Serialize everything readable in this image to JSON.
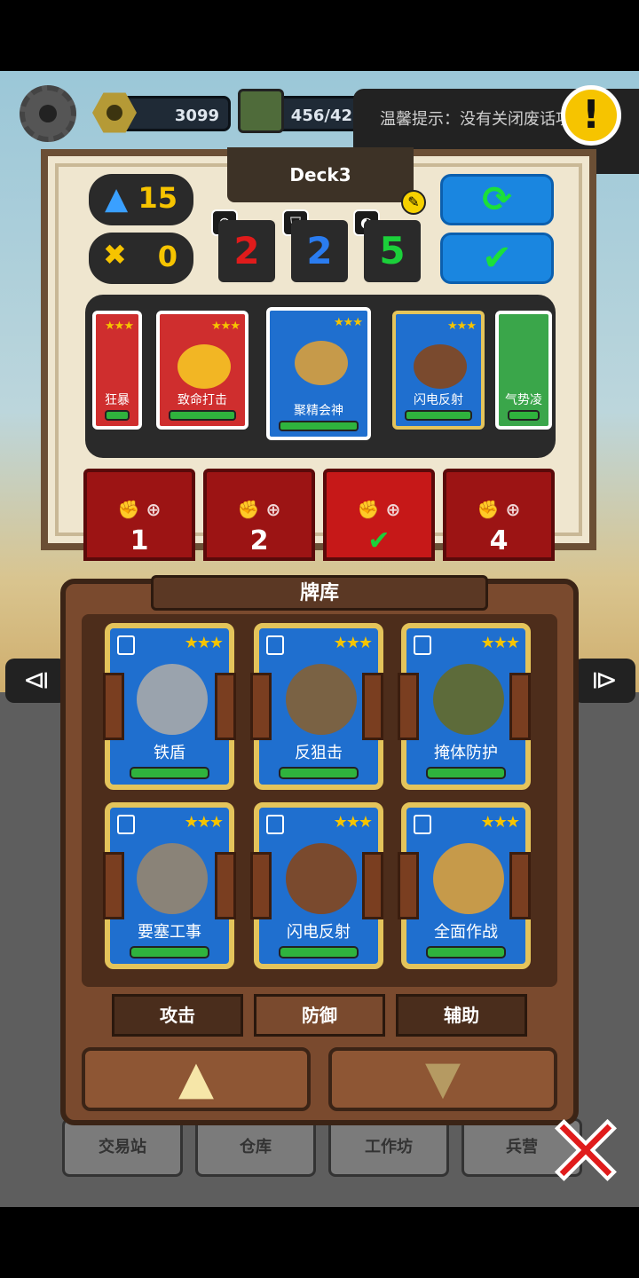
{
  "resources": {
    "nuts": "3099",
    "supplies": "456/42"
  },
  "toast": {
    "text": "温馨提示：没有关闭废话项…"
  },
  "deck": {
    "title": "Deck3"
  },
  "counters": {
    "cost": "15",
    "badge": "0"
  },
  "stats": {
    "attack": "2",
    "defense": "2",
    "support": "5"
  },
  "strip_cards": [
    {
      "label": "狂暴",
      "color": "red"
    },
    {
      "label": "致命打击",
      "color": "red"
    },
    {
      "label": "聚精会神",
      "color": "blue"
    },
    {
      "label": "闪电反射",
      "color": "blue"
    },
    {
      "label": "气势凌",
      "color": "green"
    }
  ],
  "slots": [
    "1",
    "2",
    "✔",
    "4"
  ],
  "library": {
    "title": "牌库",
    "cards": [
      {
        "label": "铁盾",
        "stars": "★★★"
      },
      {
        "label": "反狙击",
        "stars": "★★★"
      },
      {
        "label": "掩体防护",
        "stars": "★★★"
      },
      {
        "label": "要塞工事",
        "stars": "★★★"
      },
      {
        "label": "闪电反射",
        "stars": "★★★"
      },
      {
        "label": "全面作战",
        "stars": "★★★"
      }
    ],
    "tabs": [
      "攻击",
      "防御",
      "辅助"
    ]
  },
  "bottom_nav": [
    "交易站",
    "仓库",
    "工作坊",
    "兵营"
  ],
  "colors": {
    "accent_blue": "#1a86e0",
    "accent_red": "#9c1414",
    "star": "#f6c400"
  }
}
